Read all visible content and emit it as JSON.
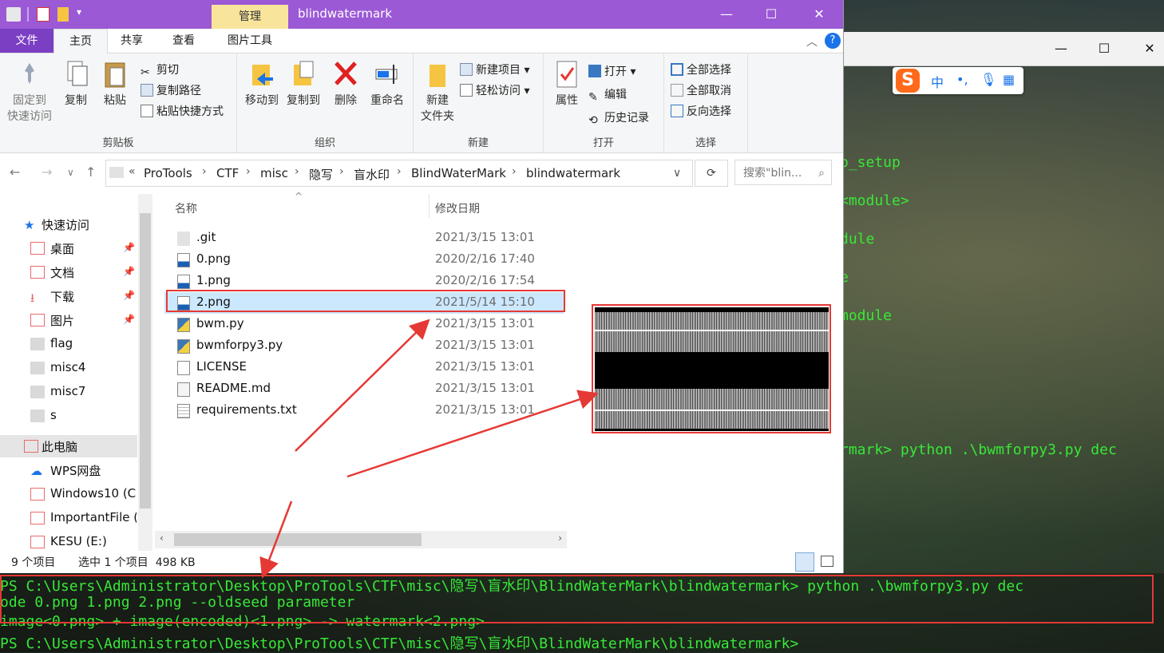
{
  "window": {
    "title": "blindwatermark",
    "context_tab": "管理",
    "controls": {
      "minimize": "—",
      "maximize": "☐",
      "close": "✕"
    }
  },
  "tabs": [
    "文件",
    "主页",
    "共享",
    "查看",
    "图片工具"
  ],
  "ribbon": {
    "clipboard": {
      "label": "剪贴板",
      "pin": "固定到\n快速访问",
      "pin_l1": "固定到",
      "pin_l2": "快速访问",
      "copy": "复制",
      "paste": "粘贴",
      "cut": "剪切",
      "copy_path": "复制路径",
      "paste_shortcut": "粘贴快捷方式"
    },
    "organize": {
      "label": "组织",
      "move_to": "移动到",
      "copy_to": "复制到",
      "delete": "删除",
      "rename": "重命名"
    },
    "new": {
      "label": "新建",
      "new_folder_l1": "新建",
      "new_folder_l2": "文件夹",
      "new_item": "新建项目",
      "easy_access": "轻松访问"
    },
    "open": {
      "label": "打开",
      "properties": "属性",
      "open": "打开",
      "edit": "编辑",
      "history": "历史记录"
    },
    "select": {
      "label": "选择",
      "select_all": "全部选择",
      "select_none": "全部取消",
      "invert": "反向选择"
    }
  },
  "address": {
    "crumbs": [
      "ProTools",
      "CTF",
      "misc",
      "隐写",
      "盲水印",
      "BlindWaterMark",
      "blindwatermark"
    ],
    "overflow": "«",
    "search_placeholder": "搜索\"blin..."
  },
  "nav": {
    "quick_access": "快速访问",
    "items": [
      {
        "label": "桌面",
        "pinned": true
      },
      {
        "label": "文档",
        "pinned": true
      },
      {
        "label": "下载",
        "pinned": true
      },
      {
        "label": "图片",
        "pinned": true
      },
      {
        "label": "flag",
        "pinned": false
      },
      {
        "label": "misc4",
        "pinned": false
      },
      {
        "label": "misc7",
        "pinned": false
      },
      {
        "label": "s",
        "pinned": false
      }
    ],
    "this_pc": "此电脑",
    "drives": [
      "WPS网盘",
      "Windows10 (C:",
      "ImportantFile (",
      "KESU (E:)"
    ]
  },
  "list": {
    "col_name": "名称",
    "col_date": "修改日期",
    "files": [
      {
        "name": ".git",
        "date": "2021/3/15 13:01",
        "type": "folder"
      },
      {
        "name": "0.png",
        "date": "2020/2/16 17:40",
        "type": "image"
      },
      {
        "name": "1.png",
        "date": "2020/2/16 17:54",
        "type": "image"
      },
      {
        "name": "2.png",
        "date": "2021/5/14 15:10",
        "type": "image",
        "selected": true
      },
      {
        "name": "bwm.py",
        "date": "2021/3/15 13:01",
        "type": "python"
      },
      {
        "name": "bwmforpy3.py",
        "date": "2021/3/15 13:01",
        "type": "python"
      },
      {
        "name": "LICENSE",
        "date": "2021/3/15 13:01",
        "type": "file"
      },
      {
        "name": "README.md",
        "date": "2021/3/15 13:01",
        "type": "md"
      },
      {
        "name": "requirements.txt",
        "date": "2021/3/15 13:01",
        "type": "txt"
      }
    ]
  },
  "status": {
    "count": "9 个项目",
    "selection": "选中 1 个项目  498 KB"
  },
  "terminal": {
    "right_lines": [
      "o_setup",
      "<module>",
      "dule",
      "e",
      "module"
    ],
    "right_cmd": "rmark> python .\\bwmforpy3.py dec",
    "bottom_lines": [
      "PS C:\\Users\\Administrator\\Desktop\\ProTools\\CTF\\misc\\隐写\\盲水印\\BlindWaterMark\\blindwatermark> python .\\bwmforpy3.py dec",
      "ode 0.png 1.png 2.png --oldseed parameter",
      "image<0.png> + image(encoded)<1.png> -> watermark<2.png>",
      "PS C:\\Users\\Administrator\\Desktop\\ProTools\\CTF\\misc\\隐写\\盲水印\\BlindWaterMark\\blindwatermark>"
    ],
    "controls": {
      "minimize": "—",
      "maximize": "☐",
      "close": "✕"
    }
  },
  "ime": {
    "logo": "S",
    "mode": "中",
    "punct": "•,"
  },
  "colors": {
    "titlebar": "#9b59d6",
    "file_tab": "#7b3fc4",
    "terminal_text": "#37e837",
    "highlight": "#e53935",
    "selected_row": "#cce8ff"
  }
}
